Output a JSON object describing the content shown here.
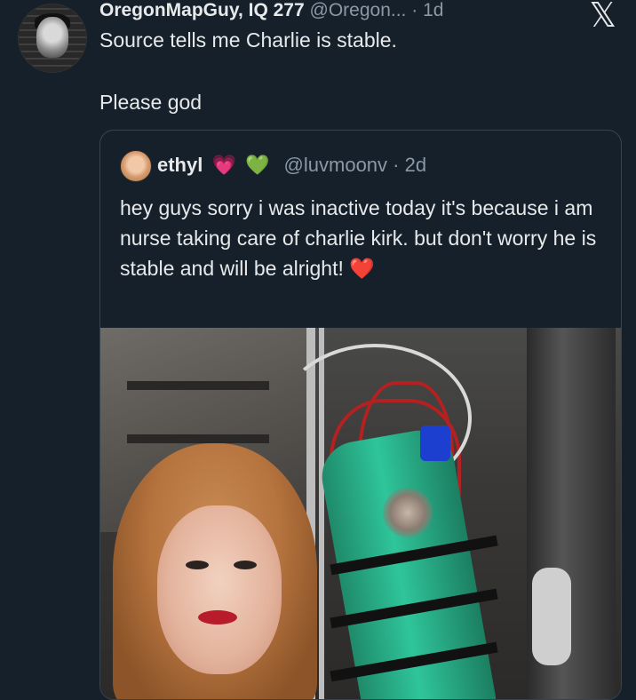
{
  "tweet": {
    "author_name": "OregonMapGuy, IQ 277",
    "author_handle": "@Oregon...",
    "time_sep": "·",
    "time": "1d",
    "text_line1": "Source tells me Charlie is stable.",
    "text_line2": "Please god",
    "avatar_icon": "avatar-portrait"
  },
  "brand": {
    "logo": "𝕏",
    "icon": "x-logo-icon"
  },
  "quoted_tweet": {
    "author_name": "ethyl",
    "heart1": "💗",
    "heart2": "💚",
    "author_handle": "@luvmoonv",
    "time_sep": "·",
    "time": "2d",
    "text": "hey guys sorry i was inactive today it's because i am nurse taking care of charlie kirk. but don't worry he is stable and will be alright!",
    "emoji_end": "❤️",
    "media_icon": "photo-image"
  },
  "colors": {
    "background": "#15202b",
    "text": "#e7e9ea",
    "muted": "#8b98a5",
    "border": "#38444d"
  }
}
